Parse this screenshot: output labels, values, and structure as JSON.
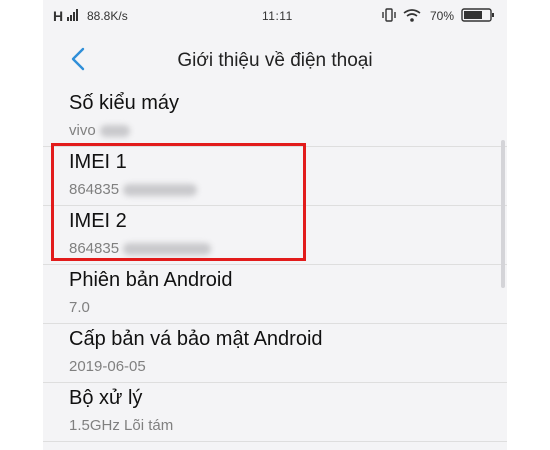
{
  "status_bar": {
    "signal": "H",
    "speed": "88.8K/s",
    "time": "11:11",
    "battery": "70%"
  },
  "header": {
    "title": "Giới thiệu về điện thoại"
  },
  "items": [
    {
      "label": "Số kiểu máy",
      "value": "vivo",
      "blurred": true
    },
    {
      "label": "IMEI 1",
      "value": "864835",
      "blurred": true
    },
    {
      "label": "IMEI 2",
      "value": "864835",
      "blurred": true
    },
    {
      "label": "Phiên bản Android",
      "value": "7.0"
    },
    {
      "label": "Cấp bản vá bảo mật Android",
      "value": "2019-06-05"
    },
    {
      "label": "Bộ xử lý",
      "value": "1.5GHz Lõi tám"
    }
  ],
  "colors": {
    "accent": "#2f8fd8",
    "highlight": "#e21b1b",
    "label": "#111111",
    "value": "#808080"
  }
}
